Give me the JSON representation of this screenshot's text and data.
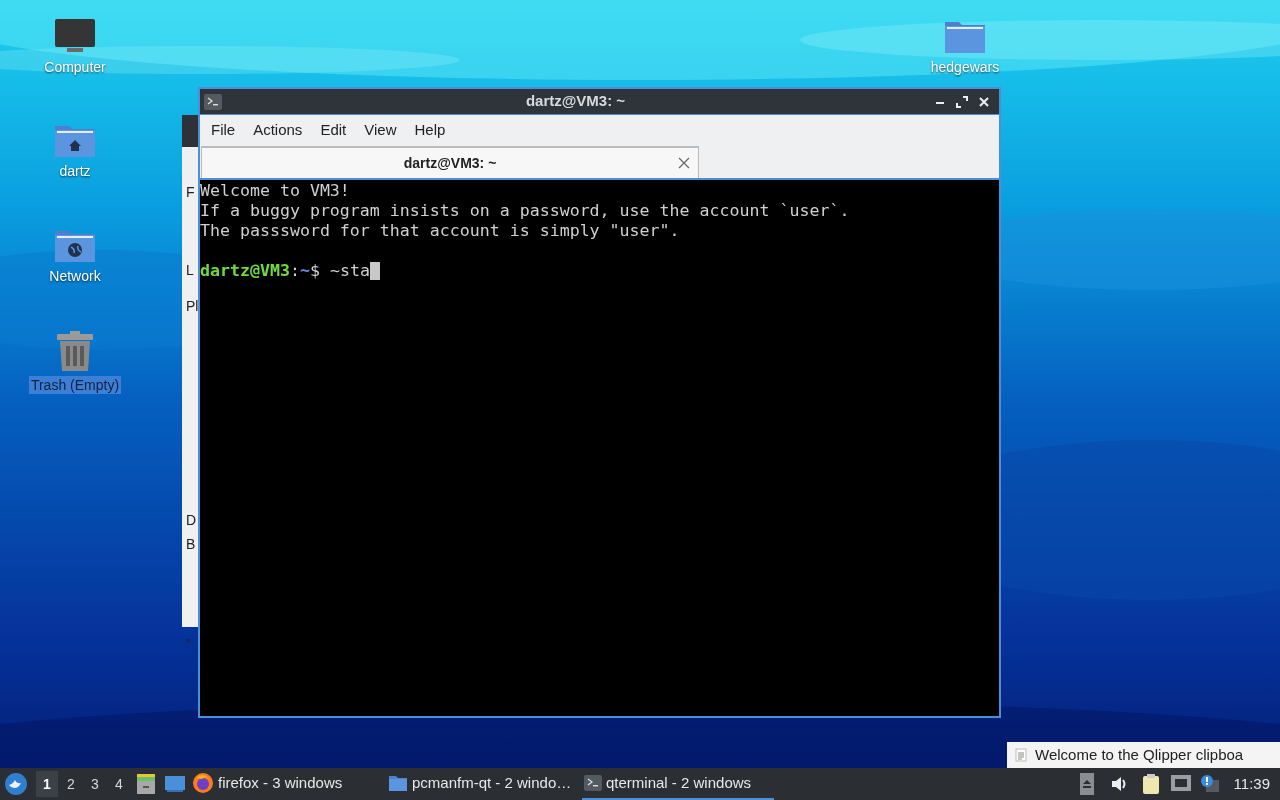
{
  "desktop": {
    "left_icons": [
      {
        "label": "Computer",
        "kind": "monitor",
        "selected": false
      },
      {
        "label": "dartz",
        "kind": "home-folder",
        "selected": false
      },
      {
        "label": "Network",
        "kind": "network-folder",
        "selected": false
      },
      {
        "label": "Trash (Empty)",
        "kind": "trash",
        "selected": true
      }
    ],
    "right_icons": [
      {
        "label": "hedgewars",
        "kind": "folder",
        "selected": false
      }
    ]
  },
  "background_window": {
    "fragments": [
      "F",
      "L",
      "Pl",
      "D",
      "B",
      "\""
    ]
  },
  "terminal": {
    "title": "dartz@VM3: ~",
    "menu": [
      "File",
      "Actions",
      "Edit",
      "View",
      "Help"
    ],
    "tabs": [
      {
        "label": "dartz@VM3: ~",
        "selected": true
      }
    ],
    "lines": [
      {
        "kind": "text",
        "text": "Welcome to VM3!"
      },
      {
        "kind": "text",
        "text": "If a buggy program insists on a password, use the account `user`."
      },
      {
        "kind": "text",
        "text": "The passsword for that account is simply \"user\"."
      },
      {
        "kind": "blank"
      },
      {
        "kind": "prompt",
        "user_host": "dartz@VM3",
        "separator": ":",
        "path": "~",
        "symbol": "$",
        "input": "~sta"
      }
    ]
  },
  "notification": {
    "text": "Welcome to the Qlipper clipboa"
  },
  "taskbar": {
    "workspaces": [
      {
        "label": "1",
        "selected": true
      },
      {
        "label": "2",
        "selected": false
      },
      {
        "label": "3",
        "selected": false
      },
      {
        "label": "4",
        "selected": false
      }
    ],
    "launchers": [
      {
        "kind": "file-cabinet"
      },
      {
        "kind": "desktop"
      }
    ],
    "tasks": [
      {
        "label": "firefox - 3 windows",
        "kind": "browser",
        "selected": false
      },
      {
        "label": "pcmanfm-qt - 2 windo…",
        "kind": "folder",
        "selected": false
      },
      {
        "label": "qterminal - 2 windows",
        "kind": "terminal",
        "selected": true
      }
    ],
    "tray": [
      {
        "kind": "eject"
      },
      {
        "kind": "volume"
      },
      {
        "kind": "clipboard"
      },
      {
        "kind": "network"
      },
      {
        "kind": "update"
      }
    ],
    "clock": "11:39"
  }
}
